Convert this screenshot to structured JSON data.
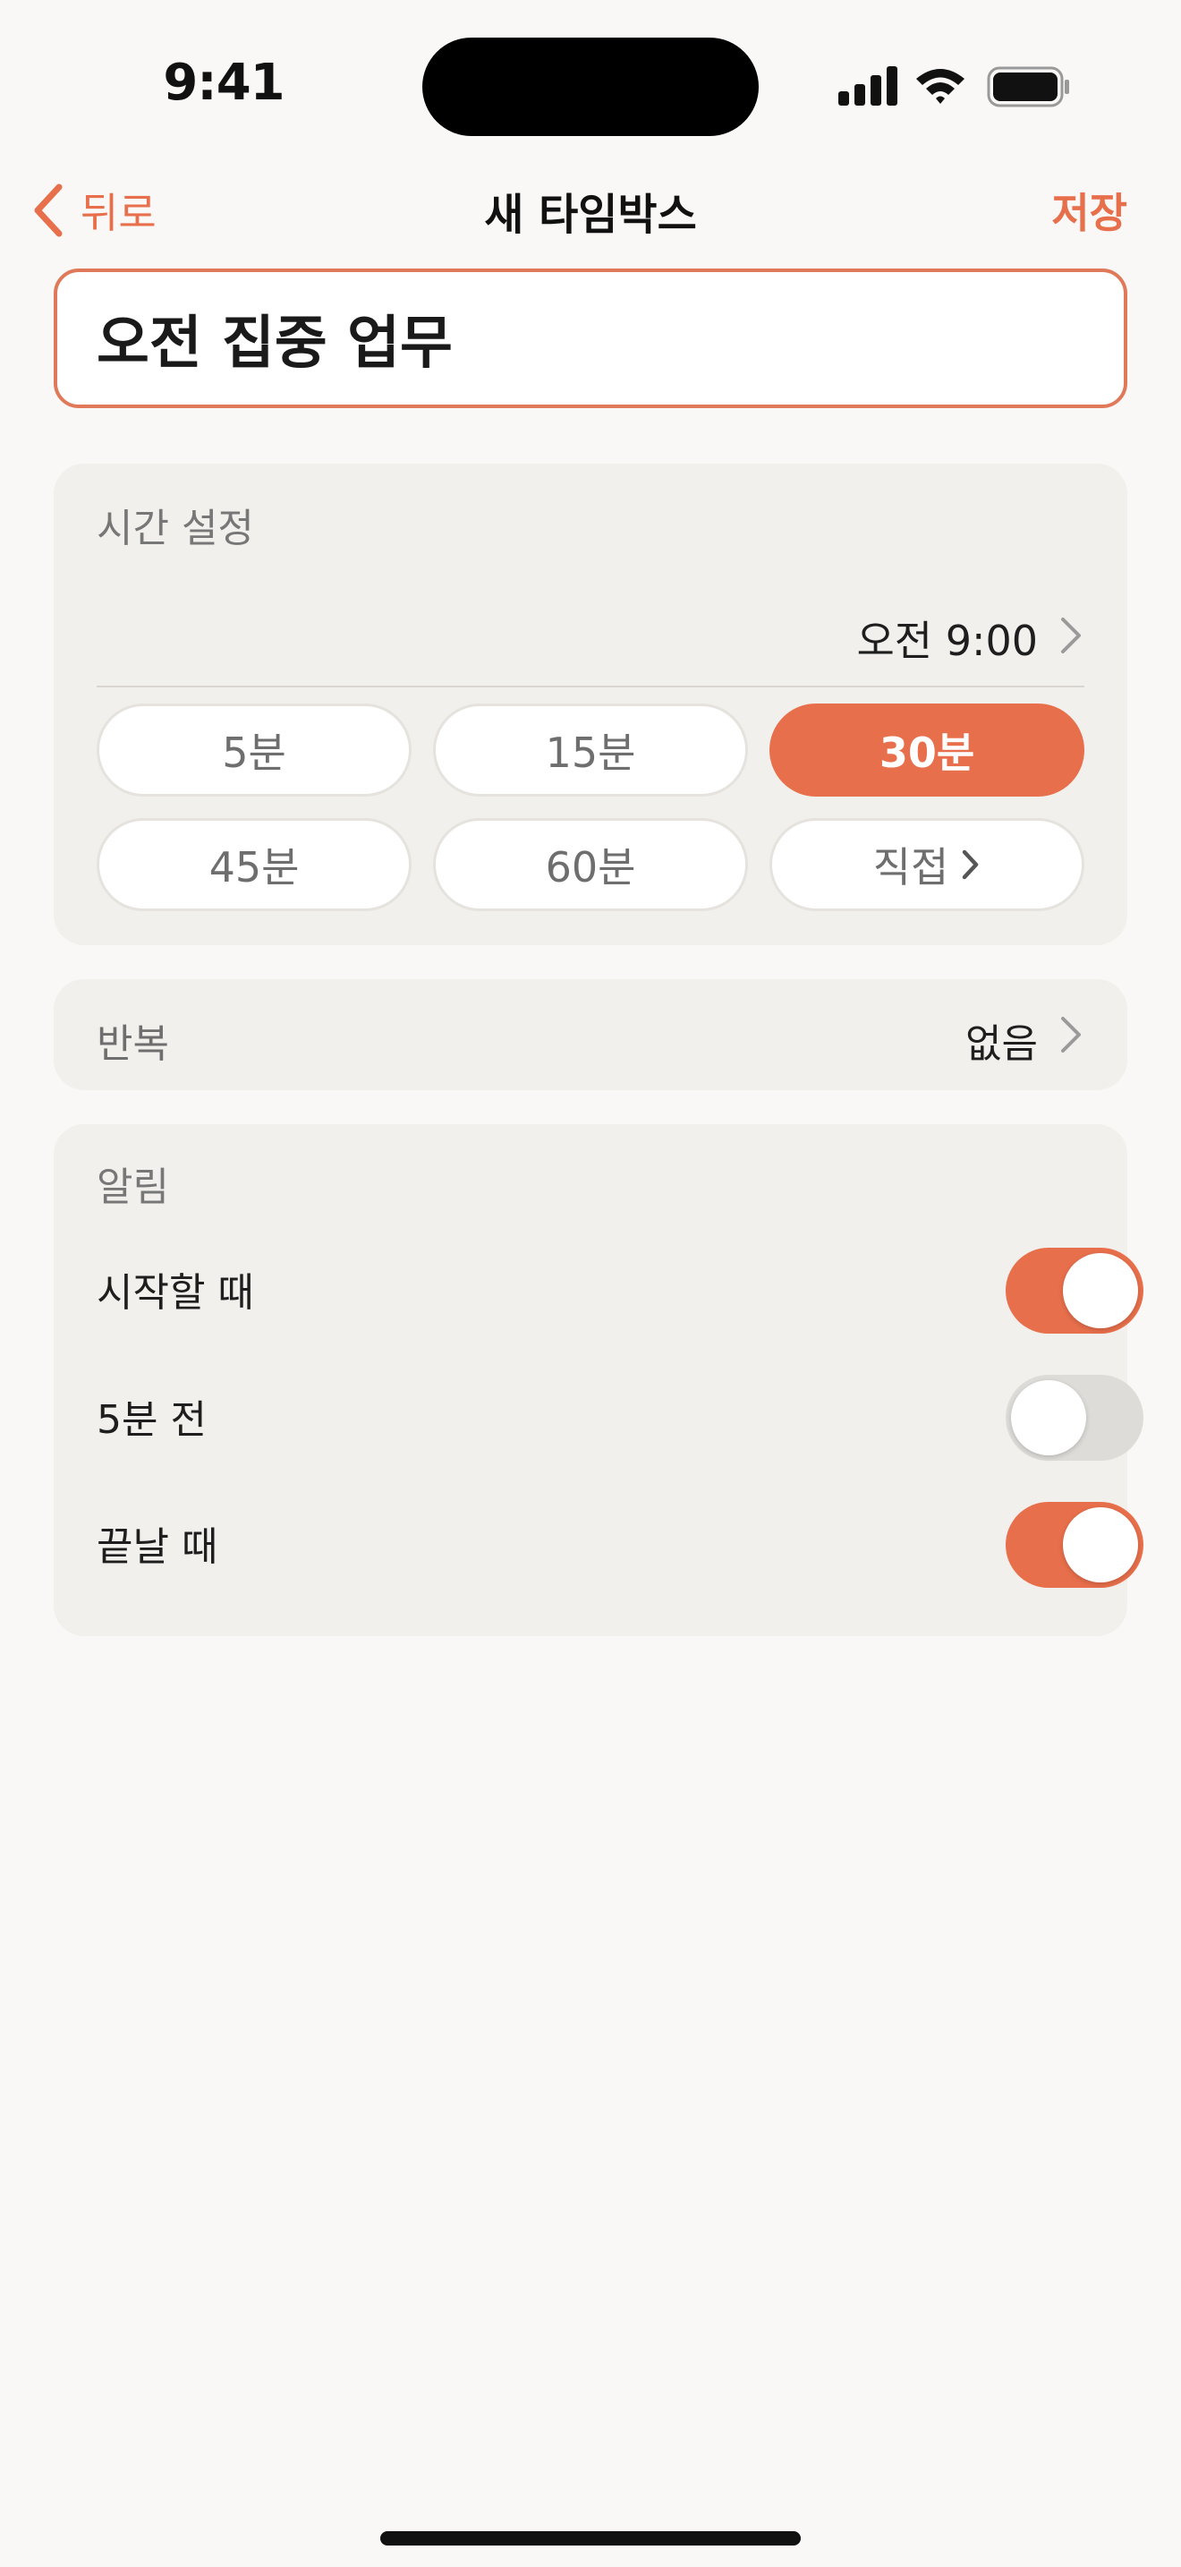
{
  "status_bar": {
    "time": "9:41"
  },
  "nav": {
    "back_label": "뒤로",
    "title": "새 타임박스",
    "save_label": "저장"
  },
  "title_field": {
    "value": "오전 집중 업무"
  },
  "time_settings": {
    "label": "시간 설정",
    "start_time": "오전 9:00",
    "durations": [
      {
        "label": "5분",
        "selected": false
      },
      {
        "label": "15분",
        "selected": false
      },
      {
        "label": "30분",
        "selected": true
      },
      {
        "label": "45분",
        "selected": false
      },
      {
        "label": "60분",
        "selected": false
      },
      {
        "label": "직접",
        "selected": false
      }
    ]
  },
  "repeat": {
    "label": "반복",
    "value": "없음"
  },
  "alerts": {
    "label": "알림",
    "items": [
      {
        "label": "시작할 때",
        "on": true
      },
      {
        "label": "5분 전",
        "on": false
      },
      {
        "label": "끝날 때",
        "on": true
      }
    ]
  },
  "colors": {
    "accent": "#e86f4b",
    "background": "#f9f8f6",
    "card": "#f2f0ec"
  }
}
